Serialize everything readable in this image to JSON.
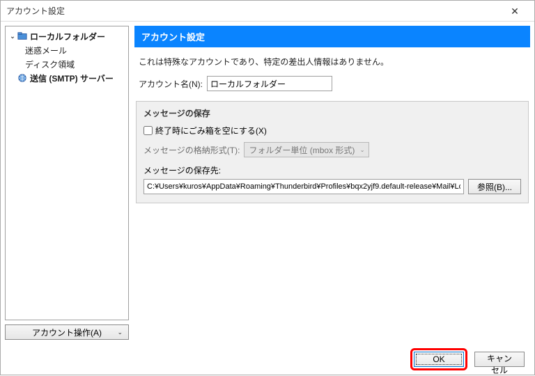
{
  "window": {
    "title": "アカウント設定"
  },
  "sidebar": {
    "items": [
      {
        "label": "ローカルフォルダー"
      },
      {
        "label": "迷惑メール"
      },
      {
        "label": "ディスク領域"
      },
      {
        "label": "送信 (SMTP) サーバー"
      }
    ],
    "acctOps": "アカウント操作(A)"
  },
  "panel": {
    "header": "アカウント設定",
    "desc": "これは特殊なアカウントであり、特定の差出人情報はありません。",
    "acctNameLabel": "アカウント名(N):",
    "acctNameValue": "ローカルフォルダー"
  },
  "storage": {
    "title": "メッセージの保存",
    "emptyTrashLabel": "終了時にごみ箱を空にする(X)",
    "emptyTrashChecked": false,
    "formatLabel": "メッセージの格納形式(T):",
    "formatValue": "フォルダー単位 (mbox 形式)",
    "pathLabel": "メッセージの保存先:",
    "pathValue": "C:¥Users¥kuros¥AppData¥Roaming¥Thunderbird¥Profiles¥bqx2yjf9.default-release¥Mail¥Local F",
    "browseLabel": "参照(B)..."
  },
  "buttons": {
    "ok": "OK",
    "cancel": "キャンセル"
  }
}
